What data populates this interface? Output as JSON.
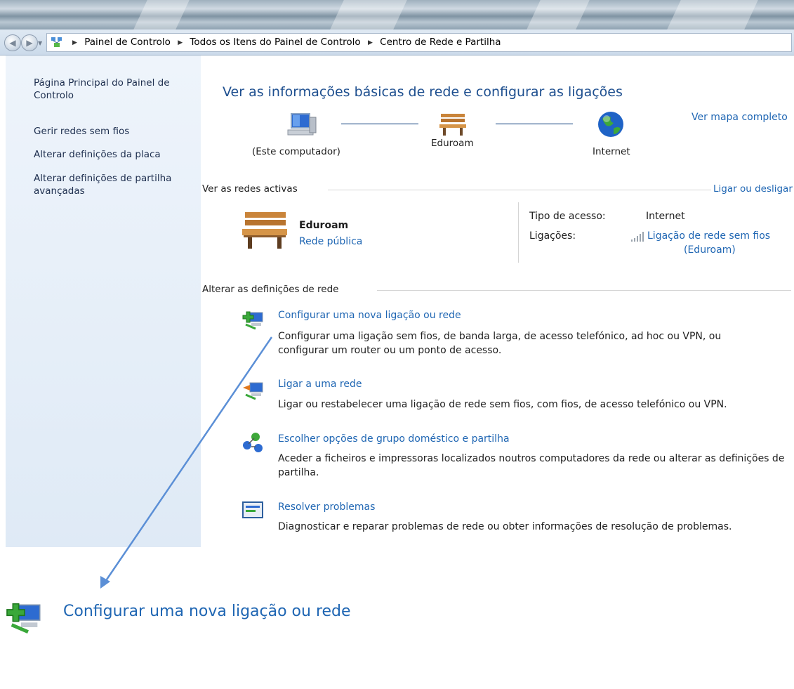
{
  "breadcrumbs": [
    "Painel de Controlo",
    "Todos os Itens do Painel de Controlo",
    "Centro de Rede e Partilha"
  ],
  "sidebar": {
    "items": [
      {
        "label": "Página Principal do Painel de Controlo"
      },
      {
        "label": "Gerir redes sem fios"
      },
      {
        "label": "Alterar definições da placa"
      },
      {
        "label": "Alterar definições de partilha avançadas"
      }
    ]
  },
  "main": {
    "title": "Ver as informações básicas de rede e configurar as ligações",
    "full_map_link": "Ver mapa completo",
    "map": {
      "computer": "(Este computador)",
      "network": "Eduroam",
      "internet": "Internet"
    },
    "active_networks": {
      "heading": "Ver as redes activas",
      "connect_link": "Ligar ou desligar",
      "network_name": "Eduroam",
      "network_type": "Rede pública",
      "access_type_label": "Tipo de acesso:",
      "access_type_value": "Internet",
      "connections_label": "Ligações:",
      "connection_link_line1": "Ligação de rede sem fios",
      "connection_link_line2": "(Eduroam)"
    },
    "change_settings": {
      "heading": "Alterar as definições de rede",
      "tasks": [
        {
          "title": "Configurar uma nova ligação ou rede",
          "desc": "Configurar uma ligação sem fios, de banda larga, de acesso telefónico, ad hoc ou VPN, ou configurar um router ou um ponto de acesso."
        },
        {
          "title": "Ligar a uma rede",
          "desc": "Ligar ou restabelecer uma ligação de rede sem fios, com fios, de acesso telefónico ou VPN."
        },
        {
          "title": "Escolher opções de grupo doméstico e partilha",
          "desc": "Aceder a ficheiros e impressoras localizados noutros computadores da rede ou alterar as definições de partilha."
        },
        {
          "title": "Resolver problemas",
          "desc": "Diagnosticar e reparar problemas de rede ou obter informações de resolução de problemas."
        }
      ]
    }
  },
  "zoom": {
    "title": "Configurar uma nova ligação ou rede"
  },
  "colors": {
    "link": "#1f66b3",
    "title": "#1e4f8f",
    "sidebar_bg": "#e6eef8",
    "arrow": "#5b8fd6"
  }
}
